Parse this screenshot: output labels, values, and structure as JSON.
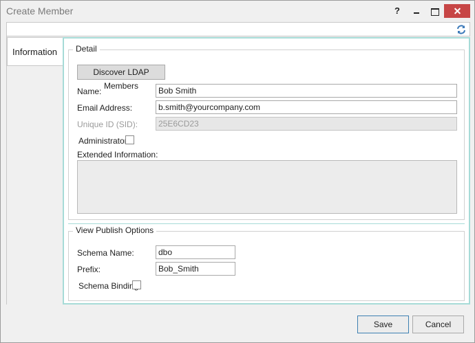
{
  "window": {
    "title": "Create Member",
    "help_label": "?"
  },
  "tabs": [
    {
      "label": "Information"
    }
  ],
  "detail": {
    "legend": "Detail",
    "discover_button": "Discover LDAP Members",
    "name_label": "Name:",
    "name_value": "Bob Smith",
    "email_label": "Email Address:",
    "email_value": "b.smith@yourcompany.com",
    "sid_label": "Unique ID (SID):",
    "sid_value": "25E6CD23",
    "admin_label": "Administrator",
    "admin_checked": false,
    "extended_label": "Extended Information:",
    "extended_value": ""
  },
  "view_publish": {
    "legend": "View Publish Options",
    "schema_label": "Schema Name:",
    "schema_value": "dbo",
    "prefix_label": "Prefix:",
    "prefix_value": "Bob_Smith",
    "binding_label": "Schema Binding",
    "binding_checked": false
  },
  "footer": {
    "save_label": "Save",
    "cancel_label": "Cancel"
  },
  "colors": {
    "accent_border": "#a6dbd7",
    "close_button": "#c74646",
    "refresh_icon": "#3a78b8"
  }
}
